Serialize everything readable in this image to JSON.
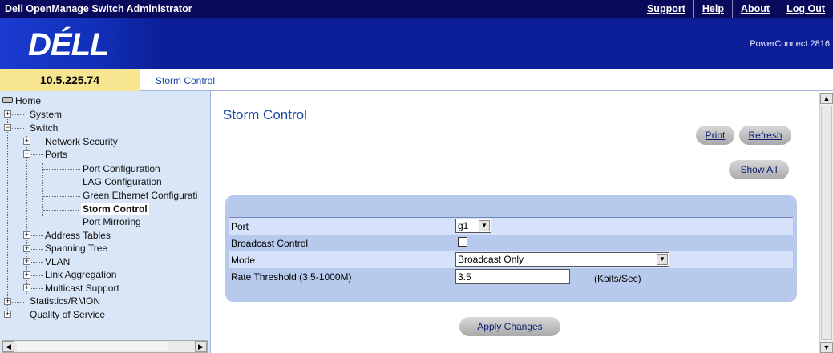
{
  "header": {
    "app_title": "Dell OpenManage Switch Administrator",
    "links": [
      "Support",
      "Help",
      "About",
      "Log Out"
    ]
  },
  "banner": {
    "logo": "DÉLL",
    "model": "PowerConnect 2816"
  },
  "infobar": {
    "ip": "10.5.225.74",
    "crumb": "Storm Control"
  },
  "tree": {
    "home": "Home",
    "system": "System",
    "switch": "Switch",
    "network_security": "Network Security",
    "ports": "Ports",
    "port_configuration": "Port Configuration",
    "lag_configuration": "LAG Configuration",
    "green_ethernet": "Green Ethernet Configurati",
    "storm_control": "Storm Control",
    "port_mirroring": "Port Mirroring",
    "address_tables": "Address Tables",
    "spanning_tree": "Spanning Tree",
    "vlan": "VLAN",
    "link_aggregation": "Link Aggregation",
    "multicast_support": "Multicast Support",
    "statistics_rmon": "Statistics/RMON",
    "quality_of_service": "Quality of Service"
  },
  "main": {
    "title": "Storm Control",
    "buttons": {
      "print": "Print",
      "refresh": "Refresh",
      "show_all": "Show All",
      "apply": "Apply Changes"
    },
    "form": {
      "port_label": "Port",
      "port_value": "g1",
      "broadcast_label": "Broadcast Control",
      "broadcast_checked": false,
      "mode_label": "Mode",
      "mode_value": "Broadcast Only",
      "rate_label": "Rate Threshold (3.5-1000M)",
      "rate_value": "3.5",
      "rate_unit": "(Kbits/Sec)"
    }
  },
  "colors": {
    "topbar": "#0a0a5c",
    "banner": "#0c1f98",
    "ip_box": "#f7e58f",
    "tree_bg": "#d9e6f7",
    "form_panel": "#b8c9ee",
    "link_blue": "#1a4aa8"
  }
}
